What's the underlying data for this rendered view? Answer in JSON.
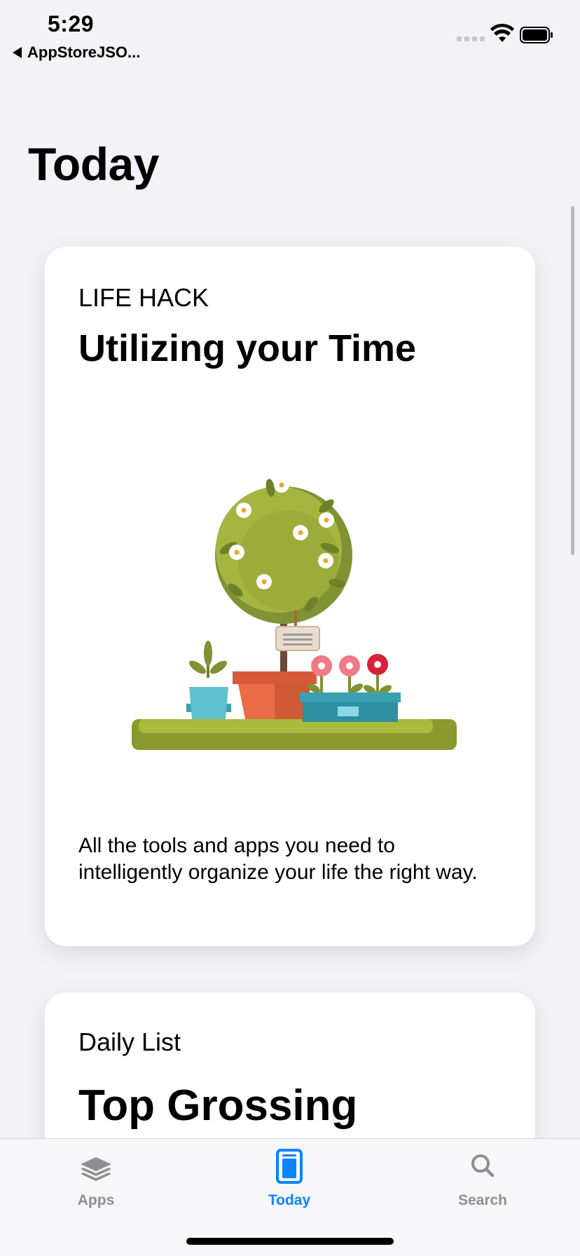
{
  "status_bar": {
    "time": "5:29",
    "back_app": "AppStoreJSO..."
  },
  "page": {
    "title": "Today"
  },
  "cards": [
    {
      "eyebrow": "LIFE HACK",
      "title": "Utilizing your Time",
      "description": "All the tools and apps you need to intelligently organize your life the right way.",
      "illustration": "potted-plants-illustration"
    },
    {
      "eyebrow": "Daily List",
      "title": "Top Grossing"
    }
  ],
  "tab_bar": {
    "tabs": [
      {
        "label": "Apps",
        "icon": "stack-icon",
        "selected": false
      },
      {
        "label": "Today",
        "icon": "today-card-icon",
        "selected": true
      },
      {
        "label": "Search",
        "icon": "magnifier-icon",
        "selected": false
      }
    ]
  },
  "colors": {
    "accent": "#0a84ff",
    "background": "#f2f2f7",
    "inactive_tab": "#8e8e93"
  }
}
